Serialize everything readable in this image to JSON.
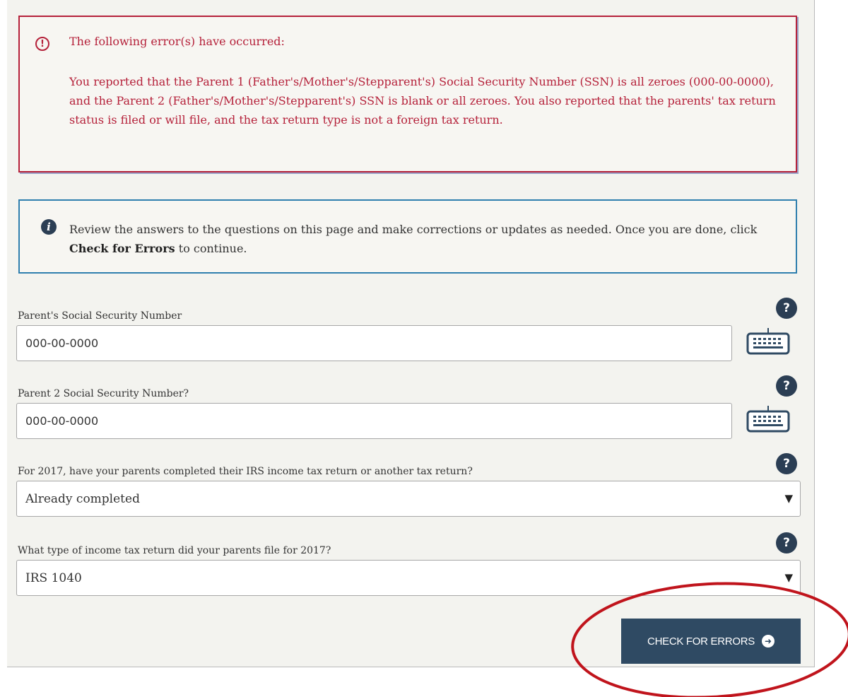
{
  "error": {
    "icon": "error-circle-icon",
    "title": "The following error(s) have occurred:",
    "message": "You reported that the Parent 1 (Father's/Mother's/Stepparent's) Social Security Number (SSN) is all zeroes (000-00-0000), and the Parent 2 (Father's/Mother's/Stepparent's) SSN is blank or all zeroes. You also reported that the parents' tax return status is filed or will file, and the tax return type is not a foreign tax return."
  },
  "info": {
    "icon": "info-icon",
    "text_before": "Review the answers to the questions on this page and make corrections or updates as needed. Once you are done, click ",
    "text_bold": "Check for Errors",
    "text_after": " to continue."
  },
  "fields": {
    "parent1_ssn": {
      "label": "Parent's Social Security Number",
      "value": "000-00-0000",
      "help": "?"
    },
    "parent2_ssn": {
      "label": "Parent 2 Social Security Number?",
      "value": "000-00-0000",
      "help": "?"
    },
    "tax_return_status": {
      "label": "For 2017, have your parents completed their IRS income tax return or another tax return?",
      "value": "Already completed",
      "help": "?"
    },
    "tax_return_type": {
      "label": "What type of income tax return did your parents file for 2017?",
      "value": "IRS 1040",
      "help": "?"
    }
  },
  "actions": {
    "check_for_errors": "CHECK FOR ERRORS"
  },
  "colors": {
    "error_red": "#b5213a",
    "info_blue": "#2f7fae",
    "navy": "#2f4a63",
    "highlight": "#c0141c"
  }
}
